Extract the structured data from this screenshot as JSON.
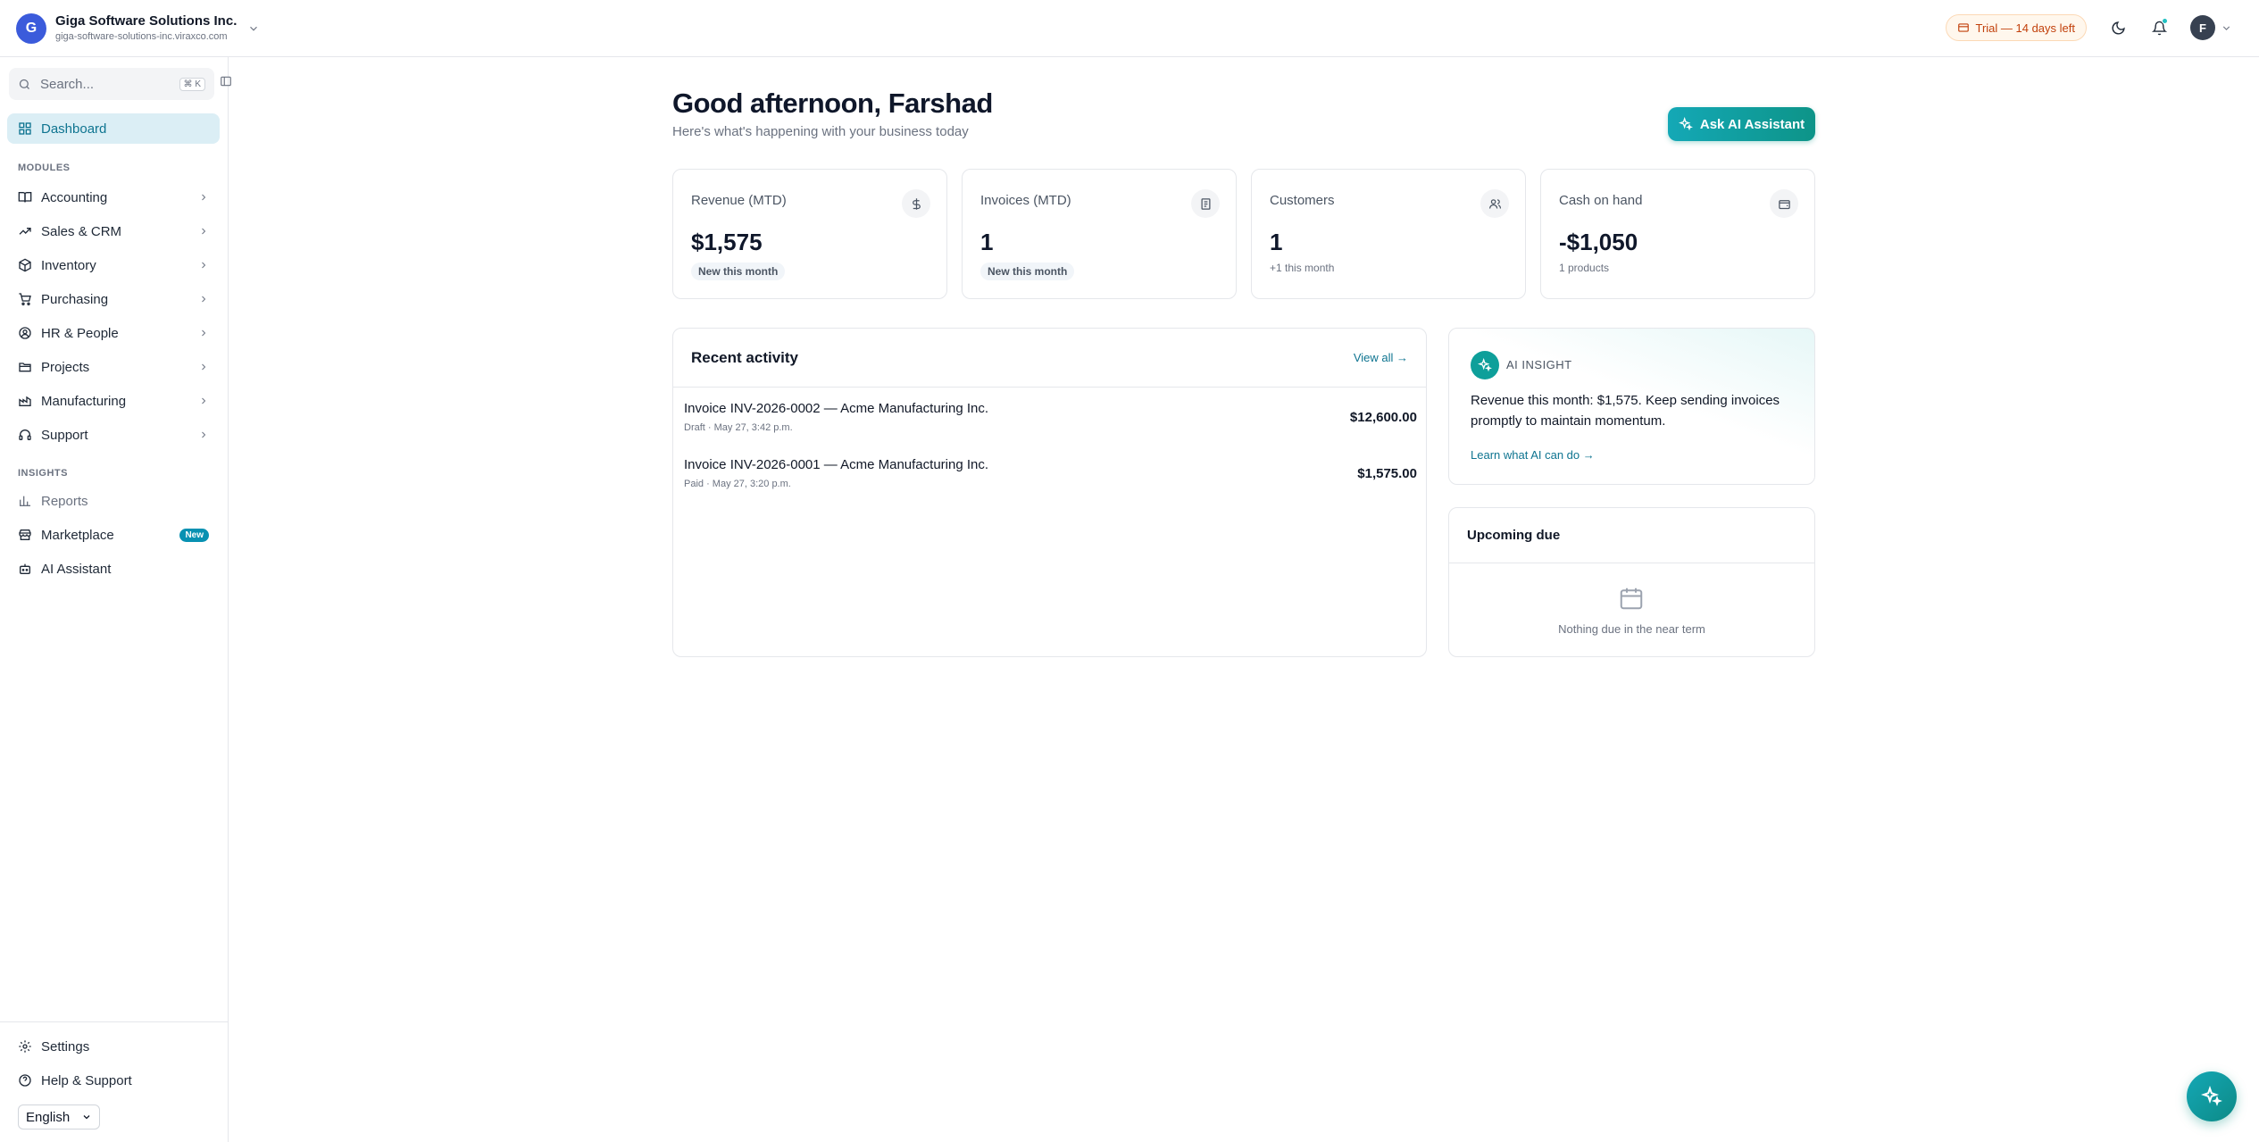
{
  "org": {
    "initial": "G",
    "name": "Giga Software Solutions Inc.",
    "domain": "giga-software-solutions-inc.viraxco.com"
  },
  "topbar": {
    "trial_label": "Trial — 14 days left",
    "user_initial": "F"
  },
  "sidebar": {
    "search_placeholder": "Search...",
    "search_shortcut": "⌘ K",
    "dashboard": "Dashboard",
    "modules_label": "MODULES",
    "modules": [
      {
        "label": "Accounting",
        "icon": "book-icon"
      },
      {
        "label": "Sales & CRM",
        "icon": "trending-up-icon"
      },
      {
        "label": "Inventory",
        "icon": "package-icon"
      },
      {
        "label": "Purchasing",
        "icon": "cart-icon"
      },
      {
        "label": "HR & People",
        "icon": "user-circle-icon"
      },
      {
        "label": "Projects",
        "icon": "folder-icon"
      },
      {
        "label": "Manufacturing",
        "icon": "factory-icon"
      },
      {
        "label": "Support",
        "icon": "headset-icon"
      }
    ],
    "insights_label": "INSIGHTS",
    "reports": "Reports",
    "marketplace": "Marketplace",
    "marketplace_badge": "New",
    "ai_assistant": "AI Assistant",
    "settings": "Settings",
    "help": "Help & Support",
    "language": "English"
  },
  "main": {
    "greeting": "Good afternoon, Farshad",
    "subgreeting": "Here's what's happening with your business today",
    "ai_button": "Ask AI Assistant",
    "stats": [
      {
        "title": "Revenue (MTD)",
        "value": "$1,575",
        "note": "New this month",
        "icon": "dollar-icon"
      },
      {
        "title": "Invoices (MTD)",
        "value": "1",
        "note": "New this month",
        "icon": "receipt-icon"
      },
      {
        "title": "Customers",
        "value": "1",
        "note": "+1 this month",
        "icon": "users-icon"
      },
      {
        "title": "Cash on hand",
        "value": "-$1,050",
        "note": "1 products",
        "icon": "wallet-icon"
      }
    ],
    "activity": {
      "title": "Recent activity",
      "view_all": "View all →",
      "items": [
        {
          "title": "Invoice INV-2026-0002 — Acme Manufacturing Inc.",
          "meta": "Draft · May 27, 3:42 p.m.",
          "amount": "$12,600.00"
        },
        {
          "title": "Invoice INV-2026-0001 — Acme Manufacturing Inc.",
          "meta": "Paid · May 27, 3:20 p.m.",
          "amount": "$1,575.00"
        }
      ]
    },
    "insight": {
      "label": "AI INSIGHT",
      "text": "Revenue this month: $1,575. Keep sending invoices promptly to maintain momentum.",
      "link": "Learn what AI can do →"
    },
    "due": {
      "title": "Upcoming due",
      "empty": "Nothing due in the near term"
    }
  },
  "colors": {
    "accent": "#0e9aa7",
    "active_nav_bg": "#dbeef5",
    "trial_text": "#c2410c"
  }
}
